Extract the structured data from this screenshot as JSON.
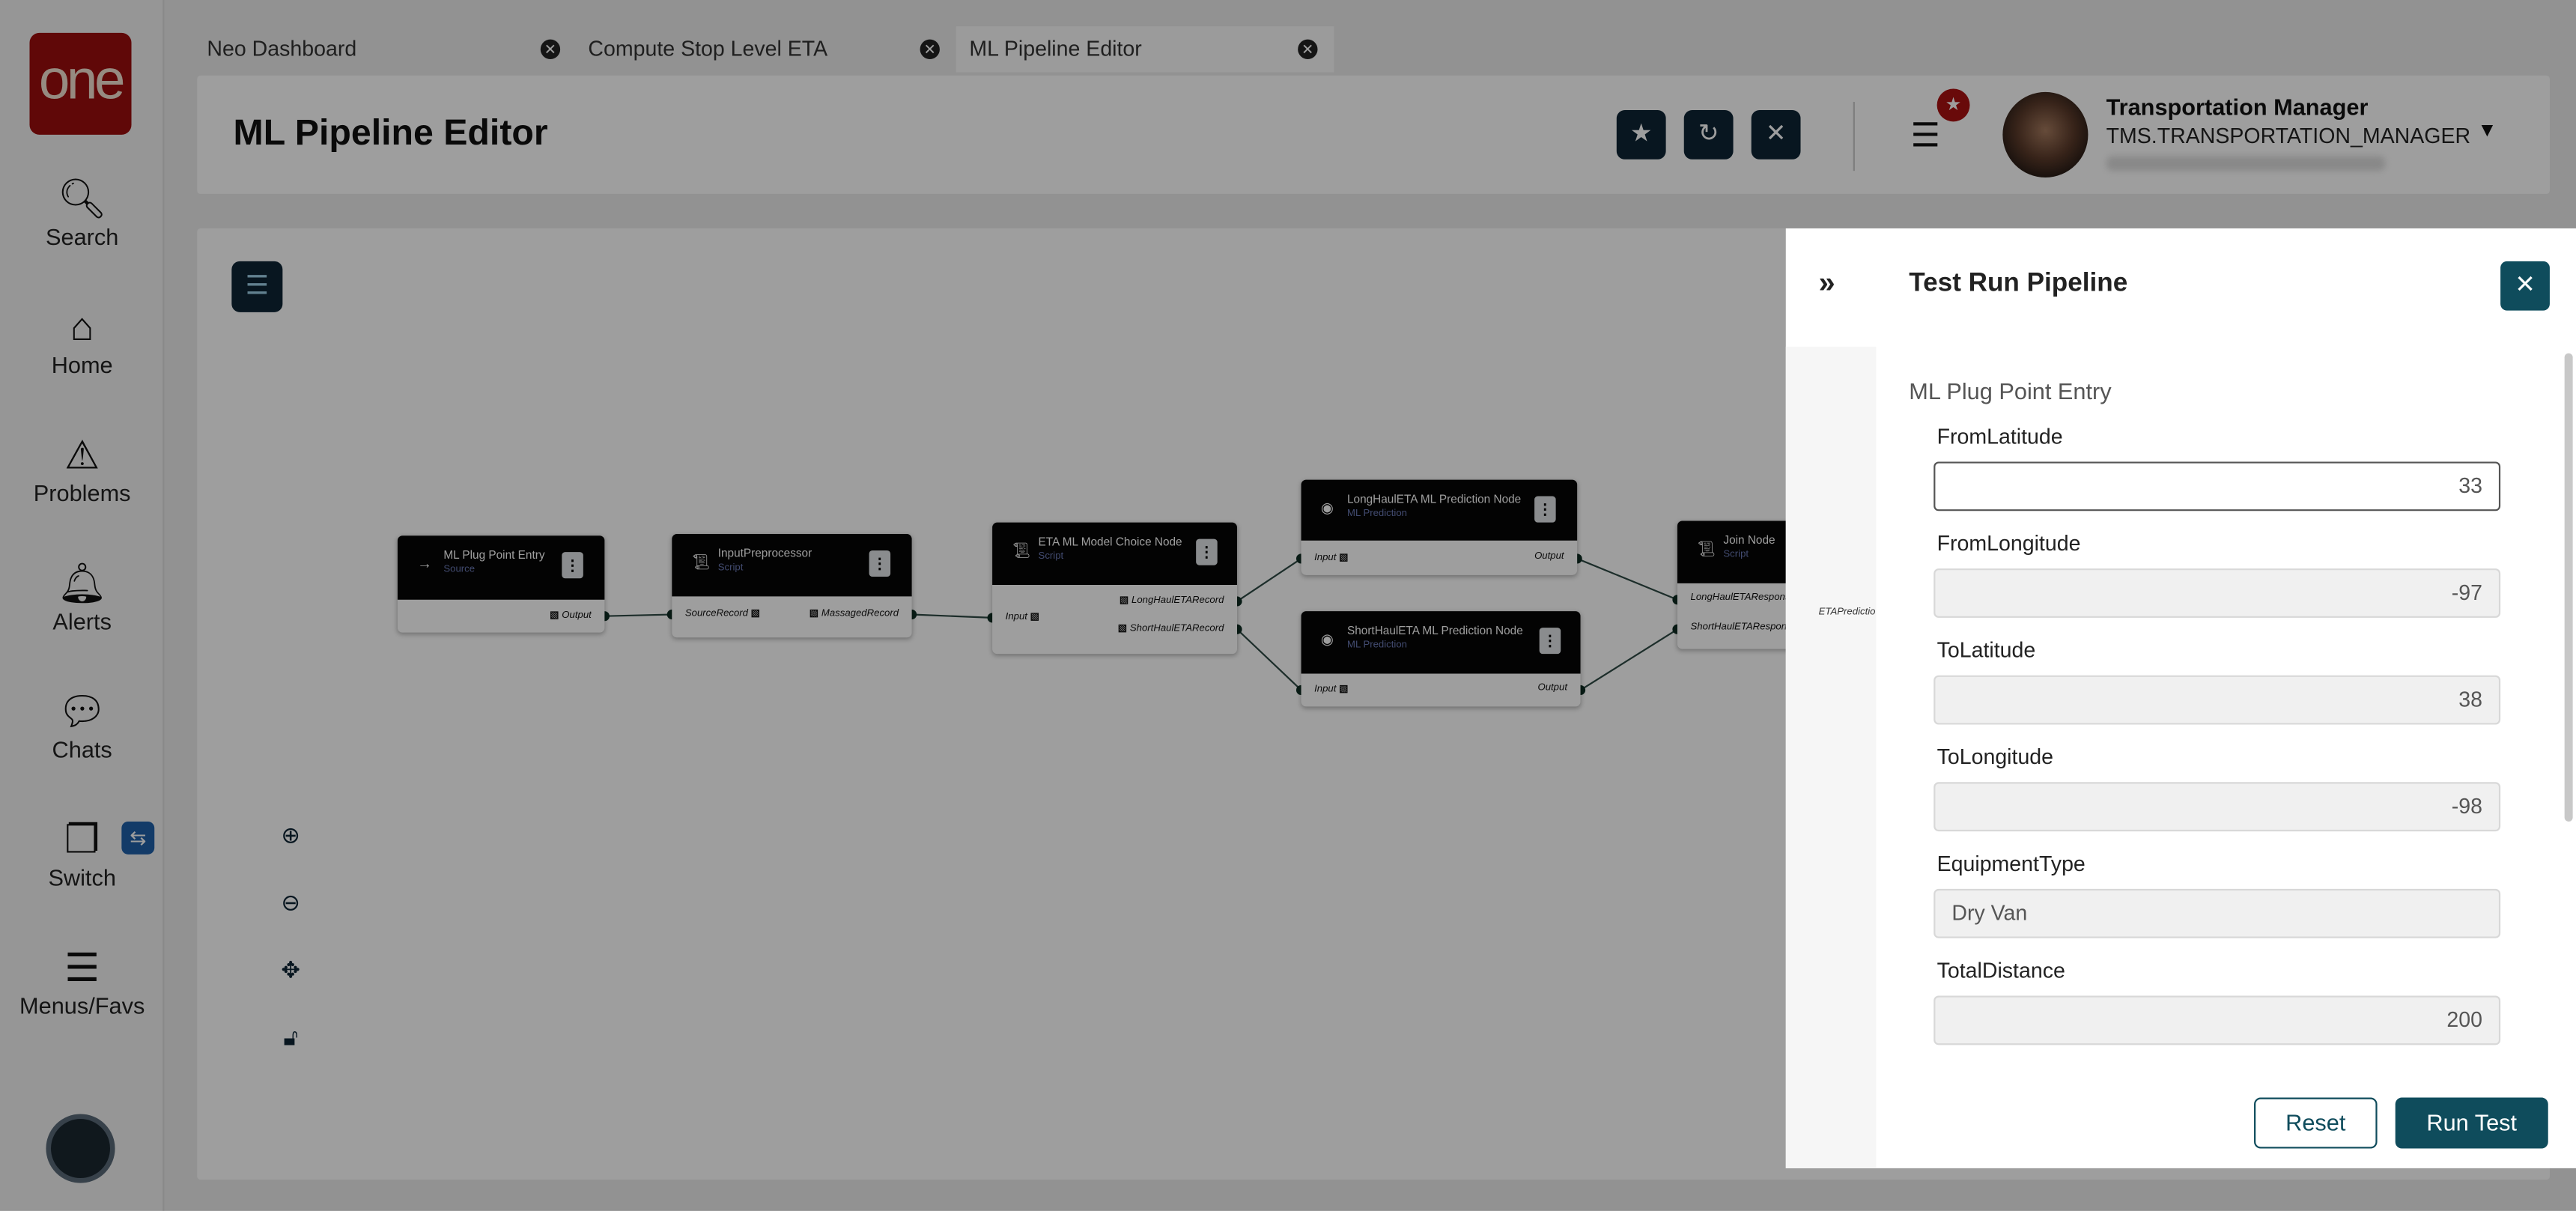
{
  "sidebar": {
    "logo": "one",
    "items": [
      {
        "label": "Search",
        "icon": "search-icon"
      },
      {
        "label": "Home",
        "icon": "home-icon"
      },
      {
        "label": "Problems",
        "icon": "warning-icon"
      },
      {
        "label": "Alerts",
        "icon": "bell-icon"
      },
      {
        "label": "Chats",
        "icon": "chat-icon"
      },
      {
        "label": "Switch",
        "icon": "switch-icon"
      },
      {
        "label": "Menus/Favs",
        "icon": "menu-icon"
      }
    ]
  },
  "tabs": [
    {
      "label": "Neo Dashboard"
    },
    {
      "label": "Compute Stop Level ETA"
    },
    {
      "label": "ML Pipeline Editor",
      "active": true
    }
  ],
  "header": {
    "title": "ML Pipeline Editor",
    "user_name": "Transportation Manager",
    "user_role": "TMS.TRANSPORTATION_MANAGER"
  },
  "nodes": [
    {
      "title": "ML Plug Point Entry",
      "type": "Source",
      "outputs": [
        "Output"
      ]
    },
    {
      "title": "InputPreprocessor",
      "type": "Script",
      "inputs": [
        "SourceRecord"
      ],
      "outputs": [
        "MassagedRecord"
      ]
    },
    {
      "title": "ETA ML Model Choice Node",
      "type": "Script",
      "inputs": [
        "Input"
      ],
      "outputs": [
        "LongHaulETARecord",
        "ShortHaulETARecord"
      ]
    },
    {
      "title": "LongHaulETA ML Prediction Node",
      "type": "ML Prediction",
      "inputs": [
        "Input"
      ],
      "outputs": [
        "Output"
      ]
    },
    {
      "title": "ShortHaulETA ML Prediction Node",
      "type": "ML Prediction",
      "inputs": [
        "Input"
      ],
      "outputs": [
        "Output"
      ]
    },
    {
      "title": "Join Node",
      "type": "Script",
      "inputs": [
        "LongHaulETAResponse",
        "ShortHaulETAResponse"
      ],
      "outputs": [
        "ETAPredictio"
      ]
    }
  ],
  "panel": {
    "title": "Test Run Pipeline",
    "section": "ML Plug Point Entry",
    "fields": [
      {
        "label": "FromLatitude",
        "value": "33"
      },
      {
        "label": "FromLongitude",
        "value": "-97"
      },
      {
        "label": "ToLatitude",
        "value": "38"
      },
      {
        "label": "ToLongitude",
        "value": "-98"
      },
      {
        "label": "EquipmentType",
        "value": "Dry Van"
      },
      {
        "label": "TotalDistance",
        "value": "200"
      }
    ],
    "reset_label": "Reset",
    "run_label": "Run Test"
  },
  "colors": {
    "accent": "#0f4c5c",
    "brand": "#9b0d0d",
    "header_button": "#0d2535"
  }
}
